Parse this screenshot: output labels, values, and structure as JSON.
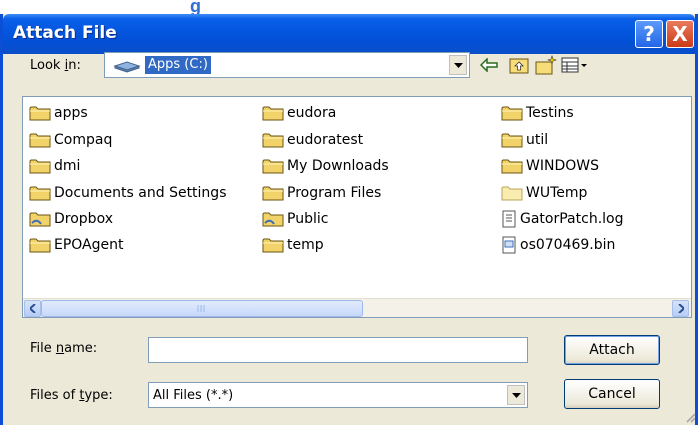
{
  "dialog": {
    "title": "Attach File",
    "help_glyph": "?",
    "close_glyph": "X",
    "accent_color": "#0a5fe8"
  },
  "lookin": {
    "label_prefix": "Look ",
    "label_mnemonic": "i",
    "label_suffix": "n:",
    "value": "Apps (C:)",
    "icon": "hard-drive-icon"
  },
  "toolbar": {
    "back_icon": "back-arrow-icon",
    "up_icon": "up-folder-icon",
    "new_folder_icon": "new-folder-icon",
    "view_icon": "view-menu-icon"
  },
  "files": {
    "columns": [
      [
        {
          "name": "apps",
          "type": "folder"
        },
        {
          "name": "Compaq",
          "type": "folder"
        },
        {
          "name": "dmi",
          "type": "folder"
        },
        {
          "name": "Documents and Settings",
          "type": "folder"
        },
        {
          "name": "Dropbox",
          "type": "shared-folder"
        },
        {
          "name": "EPOAgent",
          "type": "folder"
        }
      ],
      [
        {
          "name": "eudora",
          "type": "folder"
        },
        {
          "name": "eudoratest",
          "type": "folder"
        },
        {
          "name": "My Downloads",
          "type": "folder"
        },
        {
          "name": "Program Files",
          "type": "folder"
        },
        {
          "name": "Public",
          "type": "shared-folder"
        },
        {
          "name": "temp",
          "type": "folder"
        }
      ],
      [
        {
          "name": "Testins",
          "type": "folder"
        },
        {
          "name": "util",
          "type": "folder"
        },
        {
          "name": "WINDOWS",
          "type": "folder"
        },
        {
          "name": "WUTemp",
          "type": "folder-light"
        },
        {
          "name": "GatorPatch.log",
          "type": "text-file"
        },
        {
          "name": "os070469.bin",
          "type": "binary-file"
        }
      ]
    ]
  },
  "filename": {
    "label_prefix": "File ",
    "label_mnemonic": "n",
    "label_suffix": "ame:",
    "value": ""
  },
  "filetype": {
    "label_prefix": "Files of ",
    "label_mnemonic": "t",
    "label_suffix": "ype:",
    "value": "All Files (*.*)"
  },
  "buttons": {
    "attach": "Attach",
    "cancel": "Cancel"
  }
}
